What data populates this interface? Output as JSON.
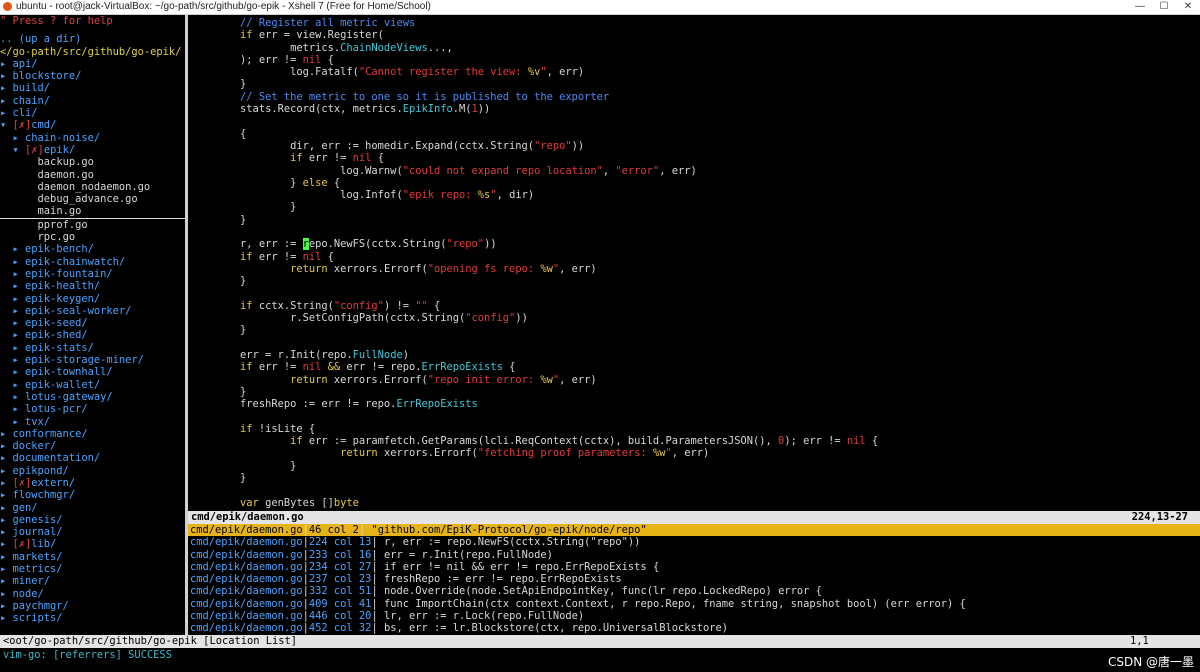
{
  "window": {
    "title": "ubuntu - root@jack-VirtualBox: ~/go-path/src/github/go-epik - Xshell 7 (Free for Home/School)",
    "minimize": "—",
    "maximize": "☐",
    "close": "✕"
  },
  "nerdtree": {
    "hint": "\" Press ? for help",
    "updir": ".. (up a dir)",
    "cwd": "</go-path/src/github/go-epik/",
    "items": [
      {
        "indent": "",
        "arrow": "▸ ",
        "mark": "",
        "name": "api/"
      },
      {
        "indent": "",
        "arrow": "▸ ",
        "mark": "",
        "name": "blockstore/"
      },
      {
        "indent": "",
        "arrow": "▸ ",
        "mark": "",
        "name": "build/"
      },
      {
        "indent": "",
        "arrow": "▸ ",
        "mark": "",
        "name": "chain/"
      },
      {
        "indent": "",
        "arrow": "▸ ",
        "mark": "",
        "name": "cli/"
      },
      {
        "indent": "",
        "arrow": "▾ ",
        "mark": "[✗]",
        "name": "cmd/"
      },
      {
        "indent": "  ",
        "arrow": "▸ ",
        "mark": "",
        "name": "chain-noise/"
      },
      {
        "indent": "  ",
        "arrow": "▾ ",
        "mark": "[✗]",
        "name": "epik/"
      },
      {
        "indent": "      ",
        "arrow": "",
        "mark": "",
        "name": "backup.go",
        "file": true
      },
      {
        "indent": "      ",
        "arrow": "",
        "mark": "",
        "name": "daemon.go",
        "file": true
      },
      {
        "indent": "      ",
        "arrow": "",
        "mark": "",
        "name": "daemon_nodaemon.go",
        "file": true
      },
      {
        "indent": "      ",
        "arrow": "",
        "mark": "",
        "name": "debug_advance.go",
        "file": true
      },
      {
        "indent": "      ",
        "arrow": "",
        "mark": "",
        "name": "main.go",
        "file": true,
        "cursor": true
      },
      {
        "indent": "      ",
        "arrow": "",
        "mark": "",
        "name": "pprof.go",
        "file": true
      },
      {
        "indent": "      ",
        "arrow": "",
        "mark": "",
        "name": "rpc.go",
        "file": true
      },
      {
        "indent": "  ",
        "arrow": "▸ ",
        "mark": "",
        "name": "epik-bench/"
      },
      {
        "indent": "  ",
        "arrow": "▸ ",
        "mark": "",
        "name": "epik-chainwatch/"
      },
      {
        "indent": "  ",
        "arrow": "▸ ",
        "mark": "",
        "name": "epik-fountain/"
      },
      {
        "indent": "  ",
        "arrow": "▸ ",
        "mark": "",
        "name": "epik-health/"
      },
      {
        "indent": "  ",
        "arrow": "▸ ",
        "mark": "",
        "name": "epik-keygen/"
      },
      {
        "indent": "  ",
        "arrow": "▸ ",
        "mark": "",
        "name": "epik-seal-worker/"
      },
      {
        "indent": "  ",
        "arrow": "▸ ",
        "mark": "",
        "name": "epik-seed/"
      },
      {
        "indent": "  ",
        "arrow": "▸ ",
        "mark": "",
        "name": "epik-shed/"
      },
      {
        "indent": "  ",
        "arrow": "▸ ",
        "mark": "",
        "name": "epik-stats/"
      },
      {
        "indent": "  ",
        "arrow": "▸ ",
        "mark": "",
        "name": "epik-storage-miner/"
      },
      {
        "indent": "  ",
        "arrow": "▸ ",
        "mark": "",
        "name": "epik-townhall/"
      },
      {
        "indent": "  ",
        "arrow": "▸ ",
        "mark": "",
        "name": "epik-wallet/"
      },
      {
        "indent": "  ",
        "arrow": "▸ ",
        "mark": "",
        "name": "lotus-gateway/"
      },
      {
        "indent": "  ",
        "arrow": "▸ ",
        "mark": "",
        "name": "lotus-pcr/"
      },
      {
        "indent": "  ",
        "arrow": "▸ ",
        "mark": "",
        "name": "tvx/"
      },
      {
        "indent": "",
        "arrow": "▸ ",
        "mark": "",
        "name": "conformance/"
      },
      {
        "indent": "",
        "arrow": "▸ ",
        "mark": "",
        "name": "docker/"
      },
      {
        "indent": "",
        "arrow": "▸ ",
        "mark": "",
        "name": "documentation/"
      },
      {
        "indent": "",
        "arrow": "▸ ",
        "mark": "",
        "name": "epikpond/"
      },
      {
        "indent": "",
        "arrow": "▸ ",
        "mark": "[✗]",
        "name": "extern/"
      },
      {
        "indent": "",
        "arrow": "▸ ",
        "mark": "",
        "name": "flowchmgr/"
      },
      {
        "indent": "",
        "arrow": "▸ ",
        "mark": "",
        "name": "gen/"
      },
      {
        "indent": "",
        "arrow": "▸ ",
        "mark": "",
        "name": "genesis/"
      },
      {
        "indent": "",
        "arrow": "▸ ",
        "mark": "",
        "name": "journal/"
      },
      {
        "indent": "",
        "arrow": "▸ ",
        "mark": "[✗]",
        "name": "lib/"
      },
      {
        "indent": "",
        "arrow": "▸ ",
        "mark": "",
        "name": "markets/"
      },
      {
        "indent": "",
        "arrow": "▸ ",
        "mark": "",
        "name": "metrics/"
      },
      {
        "indent": "",
        "arrow": "▸ ",
        "mark": "",
        "name": "miner/"
      },
      {
        "indent": "",
        "arrow": "▸ ",
        "mark": "",
        "name": "node/"
      },
      {
        "indent": "",
        "arrow": "▸ ",
        "mark": "",
        "name": "paychmgr/"
      },
      {
        "indent": "",
        "arrow": "▸ ",
        "mark": "",
        "name": "scripts/"
      }
    ]
  },
  "code": {
    "lines": [
      [
        [
          "        ",
          ""
        ],
        [
          "// Register all metric views",
          "cm"
        ]
      ],
      [
        [
          "        ",
          ""
        ],
        [
          "if",
          "kw"
        ],
        [
          " err = view.Register(",
          ""
        ]
      ],
      [
        [
          "                metrics.",
          ""
        ],
        [
          "ChainNodeViews",
          "ty"
        ],
        [
          "...,",
          ""
        ]
      ],
      [
        [
          "        ); err != ",
          ""
        ],
        [
          "nil",
          "nil"
        ],
        [
          " {",
          ""
        ]
      ],
      [
        [
          "                log.Fatalf(",
          ""
        ],
        [
          "\"Cannot register the view: ",
          "str"
        ],
        [
          "%v",
          "kw"
        ],
        [
          "\"",
          "str"
        ],
        [
          ", err)",
          ""
        ]
      ],
      [
        [
          "        }",
          ""
        ]
      ],
      [
        [
          "        ",
          ""
        ],
        [
          "// Set the metric to one so it is published to the exporter",
          "cm"
        ]
      ],
      [
        [
          "        stats.Record(ctx, metrics.",
          ""
        ],
        [
          "EpikInfo",
          "ty"
        ],
        [
          ".M(",
          ""
        ],
        [
          "1",
          "num"
        ],
        [
          "))",
          ""
        ]
      ],
      [
        [
          "",
          ""
        ]
      ],
      [
        [
          "        {",
          ""
        ]
      ],
      [
        [
          "                dir, err := homedir.Expand(cctx.String(",
          ""
        ],
        [
          "\"repo\"",
          "str"
        ],
        [
          "))",
          ""
        ]
      ],
      [
        [
          "                ",
          ""
        ],
        [
          "if",
          "kw"
        ],
        [
          " err != ",
          ""
        ],
        [
          "nil",
          "nil"
        ],
        [
          " {",
          ""
        ]
      ],
      [
        [
          "                        log.Warnw(",
          ""
        ],
        [
          "\"could not expand repo location\"",
          "str"
        ],
        [
          ", ",
          ""
        ],
        [
          "\"error\"",
          "str"
        ],
        [
          ", err)",
          ""
        ]
      ],
      [
        [
          "                } ",
          ""
        ],
        [
          "else",
          "kw"
        ],
        [
          " {",
          ""
        ]
      ],
      [
        [
          "                        log.Infof(",
          ""
        ],
        [
          "\"epik repo: ",
          "str"
        ],
        [
          "%s",
          "kw"
        ],
        [
          "\"",
          "str"
        ],
        [
          ", dir)",
          ""
        ]
      ],
      [
        [
          "                }",
          ""
        ]
      ],
      [
        [
          "        }",
          ""
        ]
      ],
      [
        [
          "",
          ""
        ]
      ],
      [
        [
          "        r, err := ",
          ""
        ],
        [
          "r",
          "cur"
        ],
        [
          "epo.NewFS(cctx.String(",
          ""
        ],
        [
          "\"repo\"",
          "str"
        ],
        [
          "))",
          ""
        ]
      ],
      [
        [
          "        ",
          ""
        ],
        [
          "if",
          "kw"
        ],
        [
          " err != ",
          ""
        ],
        [
          "nil",
          "nil"
        ],
        [
          " {",
          ""
        ]
      ],
      [
        [
          "                ",
          ""
        ],
        [
          "return",
          "kw"
        ],
        [
          " xerrors.Errorf(",
          ""
        ],
        [
          "\"opening fs repo: ",
          "str"
        ],
        [
          "%w",
          "kw"
        ],
        [
          "\"",
          "str"
        ],
        [
          ", err)",
          ""
        ]
      ],
      [
        [
          "        }",
          ""
        ]
      ],
      [
        [
          "",
          ""
        ]
      ],
      [
        [
          "        ",
          ""
        ],
        [
          "if",
          "kw"
        ],
        [
          " cctx.String(",
          ""
        ],
        [
          "\"config\"",
          "str"
        ],
        [
          ") != ",
          ""
        ],
        [
          "\"\"",
          "str"
        ],
        [
          " {",
          ""
        ]
      ],
      [
        [
          "                r.SetConfigPath(cctx.String(",
          ""
        ],
        [
          "\"config\"",
          "str"
        ],
        [
          "))",
          ""
        ]
      ],
      [
        [
          "        }",
          ""
        ]
      ],
      [
        [
          "",
          ""
        ]
      ],
      [
        [
          "        err = r.Init(repo.",
          ""
        ],
        [
          "FullNode",
          "ty"
        ],
        [
          ")",
          ""
        ]
      ],
      [
        [
          "        ",
          ""
        ],
        [
          "if",
          "kw"
        ],
        [
          " err != ",
          ""
        ],
        [
          "nil",
          "nil"
        ],
        [
          " ",
          ""
        ],
        [
          "&&",
          "kw"
        ],
        [
          " err != repo.",
          ""
        ],
        [
          "ErrRepoExists",
          "ty"
        ],
        [
          " {",
          ""
        ]
      ],
      [
        [
          "                ",
          ""
        ],
        [
          "return",
          "kw"
        ],
        [
          " xerrors.Errorf(",
          ""
        ],
        [
          "\"repo init error: ",
          "str"
        ],
        [
          "%w",
          "kw"
        ],
        [
          "\"",
          "str"
        ],
        [
          ", err)",
          ""
        ]
      ],
      [
        [
          "        }",
          ""
        ]
      ],
      [
        [
          "        freshRepo := err != repo.",
          ""
        ],
        [
          "ErrRepoExists",
          "ty"
        ]
      ],
      [
        [
          "",
          ""
        ]
      ],
      [
        [
          "        ",
          ""
        ],
        [
          "if",
          "kw"
        ],
        [
          " !isLite {",
          ""
        ]
      ],
      [
        [
          "                ",
          ""
        ],
        [
          "if",
          "kw"
        ],
        [
          " err := paramfetch.GetParams(lcli.ReqContext(cctx), build.ParametersJSON(), ",
          ""
        ],
        [
          "0",
          "num"
        ],
        [
          "); err != ",
          ""
        ],
        [
          "nil",
          "nil"
        ],
        [
          " {",
          ""
        ]
      ],
      [
        [
          "                        ",
          ""
        ],
        [
          "return",
          "kw"
        ],
        [
          " xerrors.Errorf(",
          ""
        ],
        [
          "\"fetching proof parameters: ",
          "str"
        ],
        [
          "%w",
          "kw"
        ],
        [
          "\"",
          "str"
        ],
        [
          ", err)",
          ""
        ]
      ],
      [
        [
          "                }",
          ""
        ]
      ],
      [
        [
          "        }",
          ""
        ]
      ],
      [
        [
          "",
          ""
        ]
      ],
      [
        [
          "        ",
          ""
        ],
        [
          "var",
          "kw"
        ],
        [
          " genBytes []",
          ""
        ],
        [
          "byte",
          "kw"
        ]
      ]
    ]
  },
  "code_status": {
    "file": "cmd/epik/daemon.go",
    "position": "224,13-27"
  },
  "loclist": {
    "rows": [
      {
        "file": "cmd/epik/daemon.go",
        "pos": "46 col 2",
        "text": " \"github.com/EpiK-Protocol/go-epik/node/repo\"",
        "selected": true
      },
      {
        "file": "cmd/epik/daemon.go",
        "pos": "224 col 13",
        "text": " r, err := repo.NewFS(cctx.String(\"repo\"))"
      },
      {
        "file": "cmd/epik/daemon.go",
        "pos": "233 col 16",
        "text": " err = r.Init(repo.FullNode)"
      },
      {
        "file": "cmd/epik/daemon.go",
        "pos": "234 col 27",
        "text": " if err != nil && err != repo.ErrRepoExists {"
      },
      {
        "file": "cmd/epik/daemon.go",
        "pos": "237 col 23",
        "text": " freshRepo := err != repo.ErrRepoExists"
      },
      {
        "file": "cmd/epik/daemon.go",
        "pos": "332 col 51",
        "text": " node.Override(node.SetApiEndpointKey, func(lr repo.LockedRepo) error {"
      },
      {
        "file": "cmd/epik/daemon.go",
        "pos": "409 col 41",
        "text": " func ImportChain(ctx context.Context, r repo.Repo, fname string, snapshot bool) (err error) {"
      },
      {
        "file": "cmd/epik/daemon.go",
        "pos": "446 col 20",
        "text": " lr, err := r.Lock(repo.FullNode)"
      },
      {
        "file": "cmd/epik/daemon.go",
        "pos": "452 col 32",
        "text": " bs, err := lr.Blockstore(ctx, repo.UniversalBlockstore)"
      }
    ]
  },
  "bottom_status": {
    "name": "<oot/go-path/src/github/go-epik [Location List]",
    "position": "1,1"
  },
  "cmdline": "vim-go: [referrers] SUCCESS",
  "watermark": "CSDN @唐一墨"
}
